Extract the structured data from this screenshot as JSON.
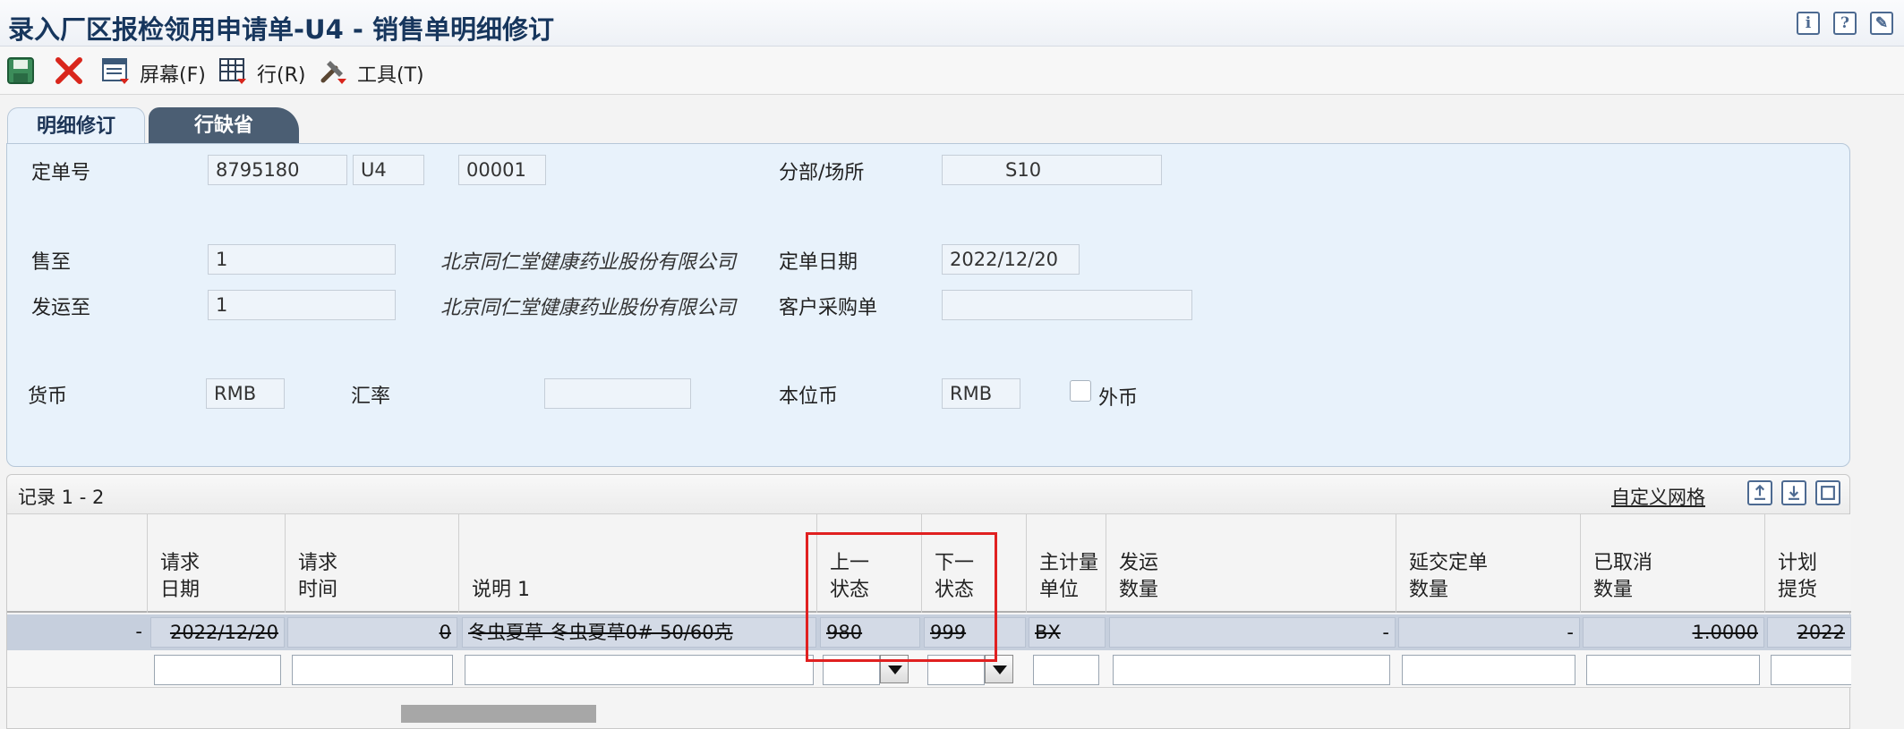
{
  "window": {
    "title": "录入厂区报检领用申请单-U4 - 销售单明细修订",
    "title_icons": [
      "info-icon",
      "help-icon",
      "personalize-icon"
    ]
  },
  "toolbar": {
    "items": [
      {
        "icon": "save-icon",
        "label": ""
      },
      {
        "icon": "cancel-icon",
        "label": ""
      },
      {
        "icon": "screen-icon",
        "label": "屏幕(F)"
      },
      {
        "icon": "row-icon",
        "label": "行(R)"
      },
      {
        "icon": "tools-icon",
        "label": "工具(T)"
      }
    ]
  },
  "tabs": [
    {
      "label": "明细修订",
      "active": true
    },
    {
      "label": "行缺省",
      "active": false
    }
  ],
  "header": {
    "order_no_label": "定单号",
    "order_no": "8795180",
    "order_type": "U4",
    "order_company": "00001",
    "branch_label": "分部/场所",
    "branch": "S10",
    "sold_to_label": "售至",
    "sold_to": "1",
    "sold_to_name": "北京同仁堂健康药业股份有限公司",
    "order_date_label": "定单日期",
    "order_date": "2022/12/20",
    "ship_to_label": "发运至",
    "ship_to": "1",
    "ship_to_name": "北京同仁堂健康药业股份有限公司",
    "customer_po_label": "客户采购单",
    "customer_po": "",
    "currency_label": "货币",
    "currency": "RMB",
    "exchange_rate_label": "汇率",
    "exchange_rate": "",
    "base_currency_label": "本位币",
    "base_currency": "RMB",
    "foreign_currency_label": "外币",
    "foreign_currency_checked": false
  },
  "grid": {
    "records_label": "记录 1 - 2",
    "customize_label": "自定义网格",
    "toolbar_icons": [
      "export-icon",
      "import-icon",
      "maximize-icon"
    ],
    "columns": [
      {
        "label": ""
      },
      {
        "label": "请求\n日期"
      },
      {
        "label": "请求\n时间"
      },
      {
        "label": "说明 1"
      },
      {
        "label": "上一\n状态"
      },
      {
        "label": "下一\n状态"
      },
      {
        "label": "主计量\n单位"
      },
      {
        "label": "发运\n数量"
      },
      {
        "label": "延交定单\n数量"
      },
      {
        "label": "已取消\n数量"
      },
      {
        "label": "计划\n提货"
      }
    ],
    "row": {
      "c0": "-",
      "request_date": "2022/12/20",
      "request_time": "0",
      "description": "冬虫夏草-冬虫夏草0#-50/60克",
      "last_status": "980",
      "next_status": "999",
      "uom": "BX",
      "ship_qty": "-",
      "backorder_qty": "-",
      "cancelled_qty": "1.0000",
      "planned_pickup": "2022"
    }
  },
  "colors": {
    "panel_bg": "#e8f2fb",
    "title": "#17365d",
    "highlight": "#e02020",
    "selected_row": "#c6cfdd"
  }
}
